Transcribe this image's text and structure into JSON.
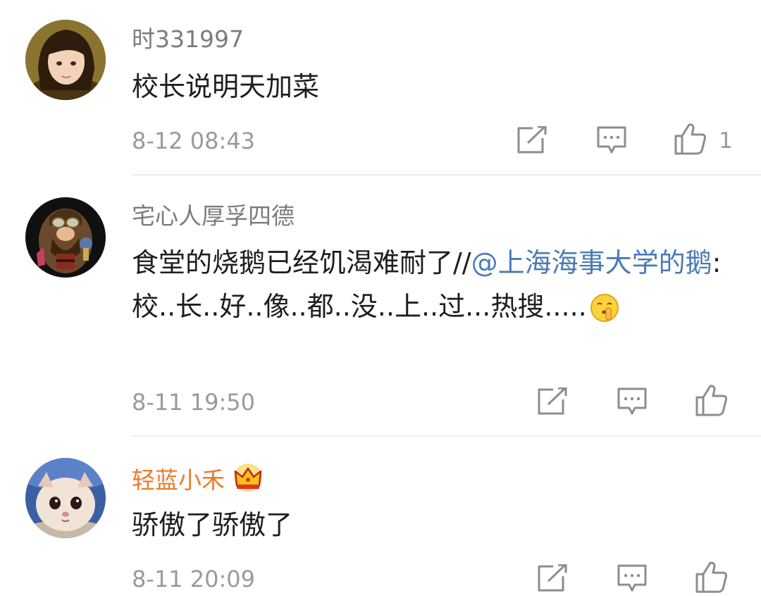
{
  "comments": [
    {
      "username": "时331997",
      "text": "校长说明天加菜",
      "time": "8-12 08:43",
      "like_count": "1"
    },
    {
      "username": "宅心人厚孚四德",
      "text_before": "食堂的烧鹅已经饥渴难耐了//",
      "mention": "@上海海事大学的鹅",
      "text_after": ":校..长..好..像..都..没..上..过...热搜.....",
      "time": "8-11 19:50",
      "like_count": ""
    },
    {
      "username": "轻蓝小禾",
      "text": "骄傲了骄傲了",
      "time": "8-11 20:09",
      "like_count": ""
    }
  ],
  "icons": {
    "repost": "repost-icon",
    "comment": "comment-icon",
    "like": "thumbs-up-icon",
    "vip": "crown-icon",
    "emoji": "shush-emoji"
  },
  "colors": {
    "username": "#7c7c7c",
    "vip_username": "#ee7a2a",
    "mention": "#4a7bb5",
    "text": "#1e1e1e",
    "meta": "#9a9a9a",
    "divider": "#ededed"
  }
}
